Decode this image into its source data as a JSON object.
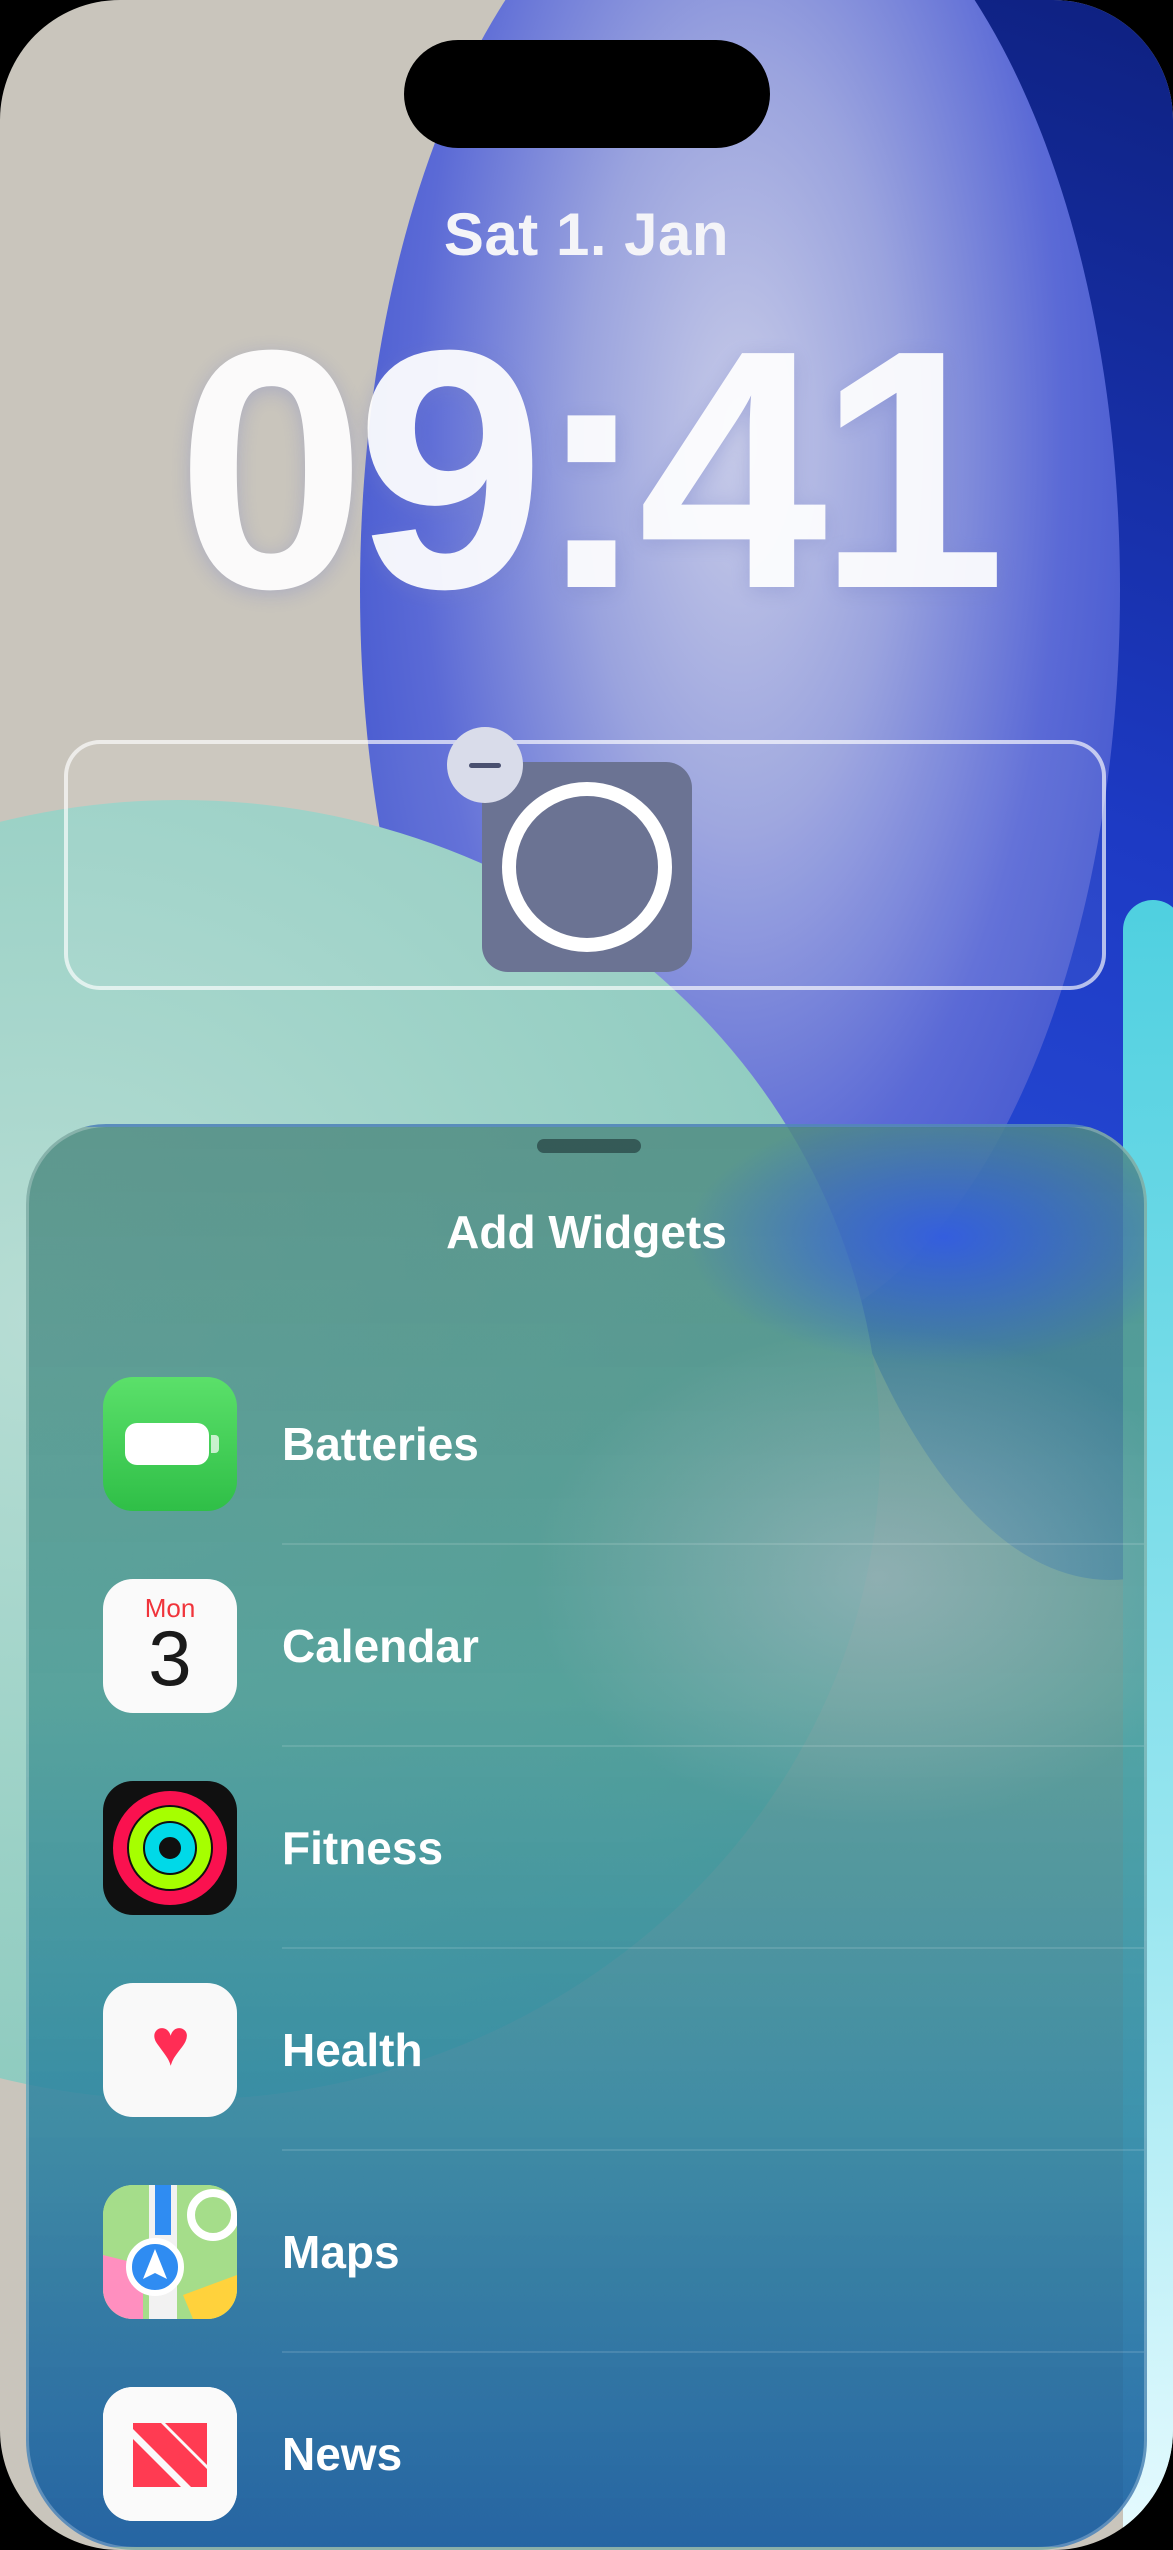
{
  "lock_screen": {
    "date": "Sat 1. Jan",
    "time": "09:41"
  },
  "sheet": {
    "title": "Add Widgets",
    "items": [
      {
        "label": "Batteries",
        "icon": "batteries-icon"
      },
      {
        "label": "Calendar",
        "icon": "calendar-icon",
        "icon_day": "Mon",
        "icon_date": "3"
      },
      {
        "label": "Fitness",
        "icon": "fitness-icon"
      },
      {
        "label": "Health",
        "icon": "health-icon"
      },
      {
        "label": "Maps",
        "icon": "maps-icon"
      },
      {
        "label": "News",
        "icon": "news-icon"
      }
    ]
  },
  "colors": {
    "batteries": "#34C759",
    "calendar_day": "#F0343B",
    "health": "#FF2D55",
    "news": "#FF3B52"
  }
}
